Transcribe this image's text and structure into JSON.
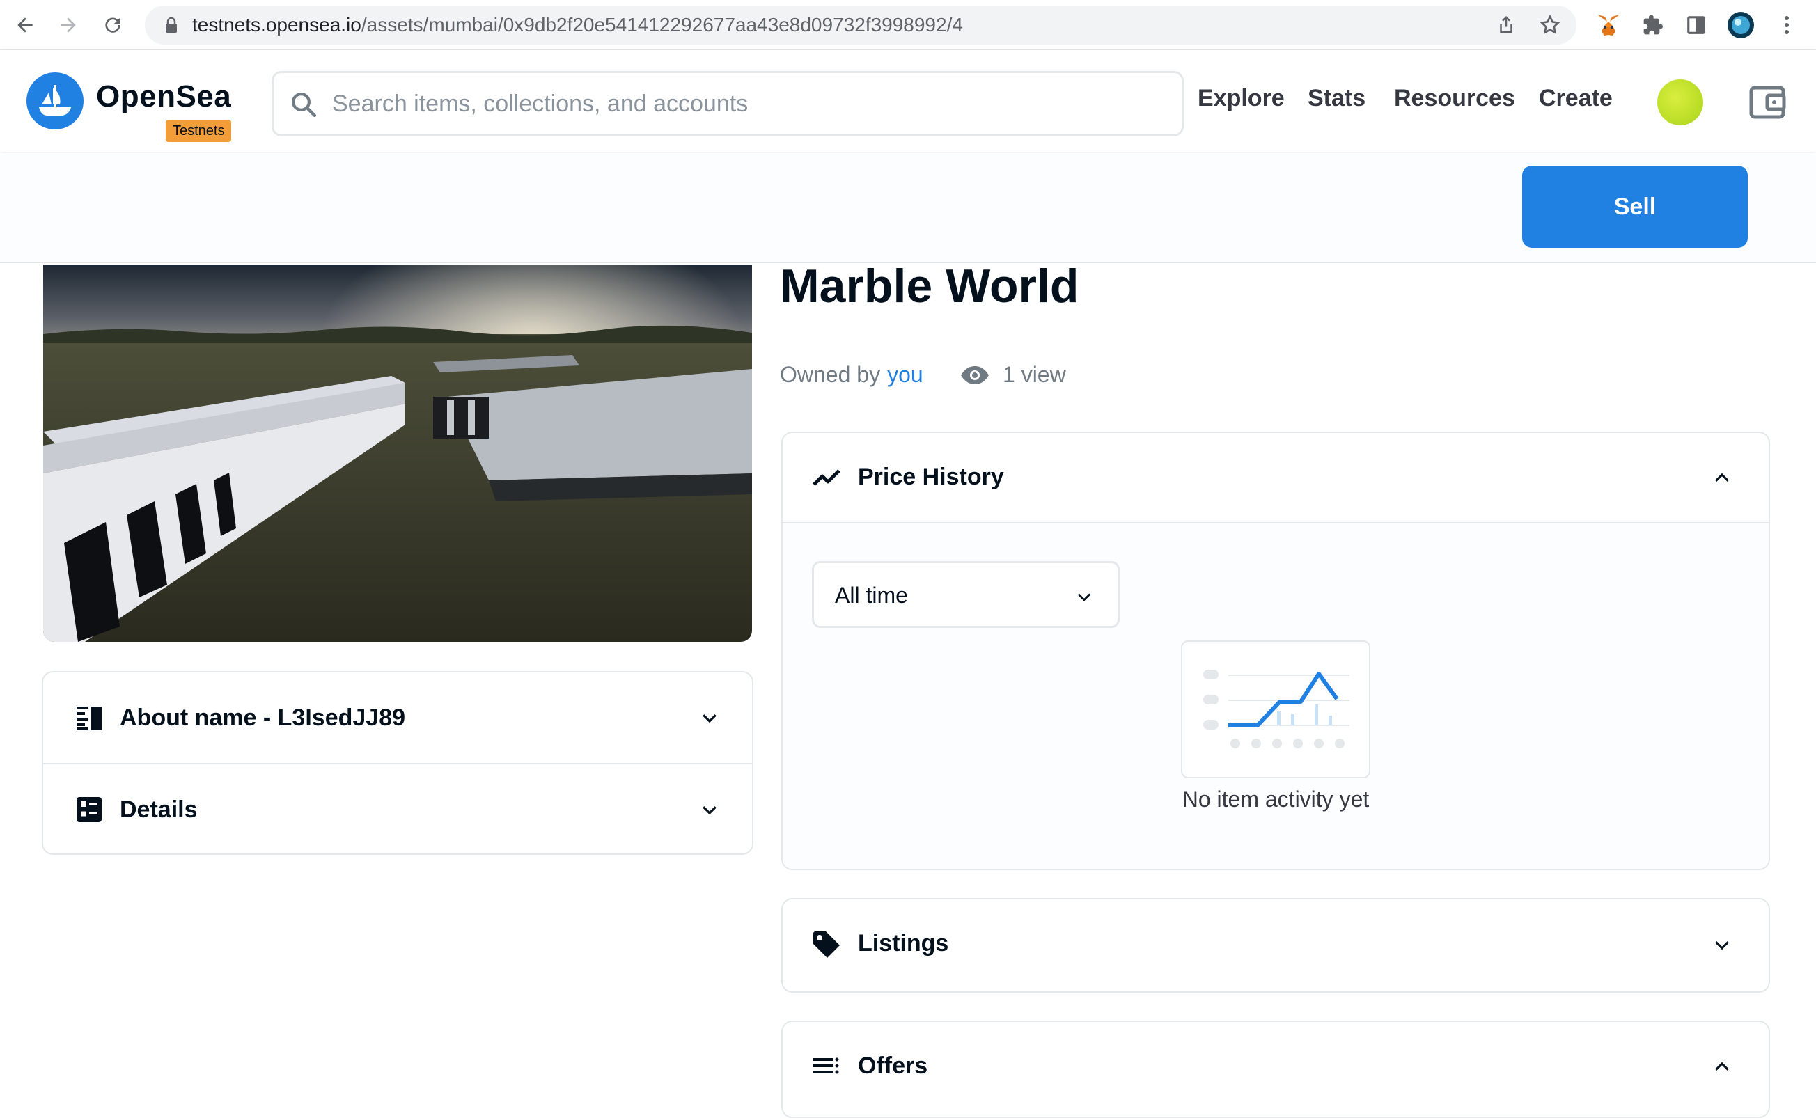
{
  "browser": {
    "url_host": "testnets.opensea.io",
    "url_path": "/assets/mumbai/0x9db2f20e541412292677aa43e8d09732f3998992/4"
  },
  "header": {
    "logo_text": "OpenSea",
    "badge": "Testnets",
    "search_placeholder": "Search items, collections, and accounts",
    "nav": {
      "explore": "Explore",
      "stats": "Stats",
      "resources": "Resources",
      "create": "Create"
    }
  },
  "actions": {
    "sell_label": "Sell"
  },
  "asset": {
    "title": "Marble World",
    "owned_by_label": "Owned by",
    "owner": "you",
    "views": "1 view"
  },
  "left_panels": {
    "about": "About name - L3IsedJJ89",
    "details": "Details"
  },
  "price_history": {
    "title": "Price History",
    "range_selected": "All time",
    "empty_text": "No item activity yet"
  },
  "listings": {
    "title": "Listings"
  },
  "offers": {
    "title": "Offers"
  },
  "colors": {
    "brand": "#2081e2",
    "badge": "#f29d38",
    "text": "#04111d",
    "muted": "#707a83"
  }
}
